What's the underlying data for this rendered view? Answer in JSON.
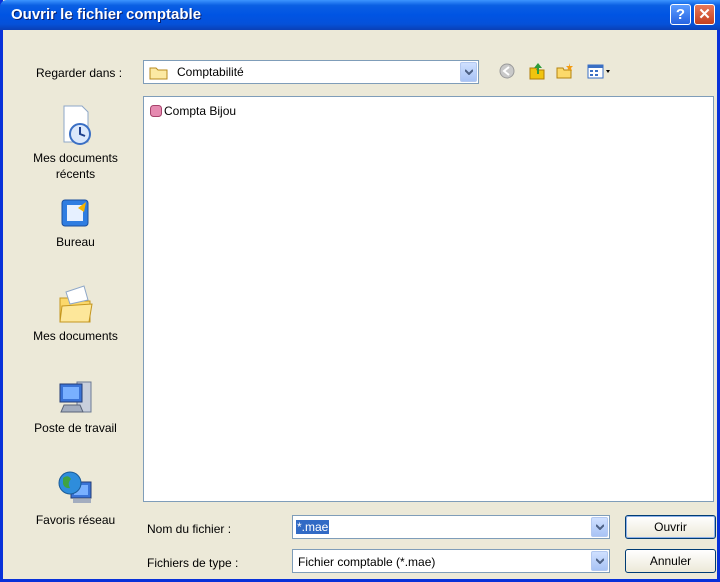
{
  "window": {
    "title": "Ouvrir le fichier comptable"
  },
  "titlebar_buttons": {
    "help": "?",
    "close": "✕"
  },
  "lookin": {
    "label": "Regarder dans :",
    "value": "Comptabilité"
  },
  "toolbar": {
    "icons": [
      "back-icon",
      "up-folder-icon",
      "new-folder-icon",
      "view-menu-icon"
    ]
  },
  "places": [
    {
      "label": "Mes documents récents",
      "icon": "recent-documents-icon"
    },
    {
      "label": "Bureau",
      "icon": "desktop-icon"
    },
    {
      "label": "Mes documents",
      "icon": "my-documents-icon"
    },
    {
      "label": "Poste de travail",
      "icon": "my-computer-icon"
    },
    {
      "label": "Favoris réseau",
      "icon": "network-places-icon"
    }
  ],
  "files": [
    {
      "name": "Compta Bijou",
      "icon": "database-file-icon"
    }
  ],
  "filename": {
    "label": "Nom du fichier :",
    "value": "*.mae"
  },
  "filetype": {
    "label": "Fichiers de type :",
    "value": "Fichier comptable (*.mae)"
  },
  "buttons": {
    "open": "Ouvrir",
    "cancel": "Annuler"
  }
}
